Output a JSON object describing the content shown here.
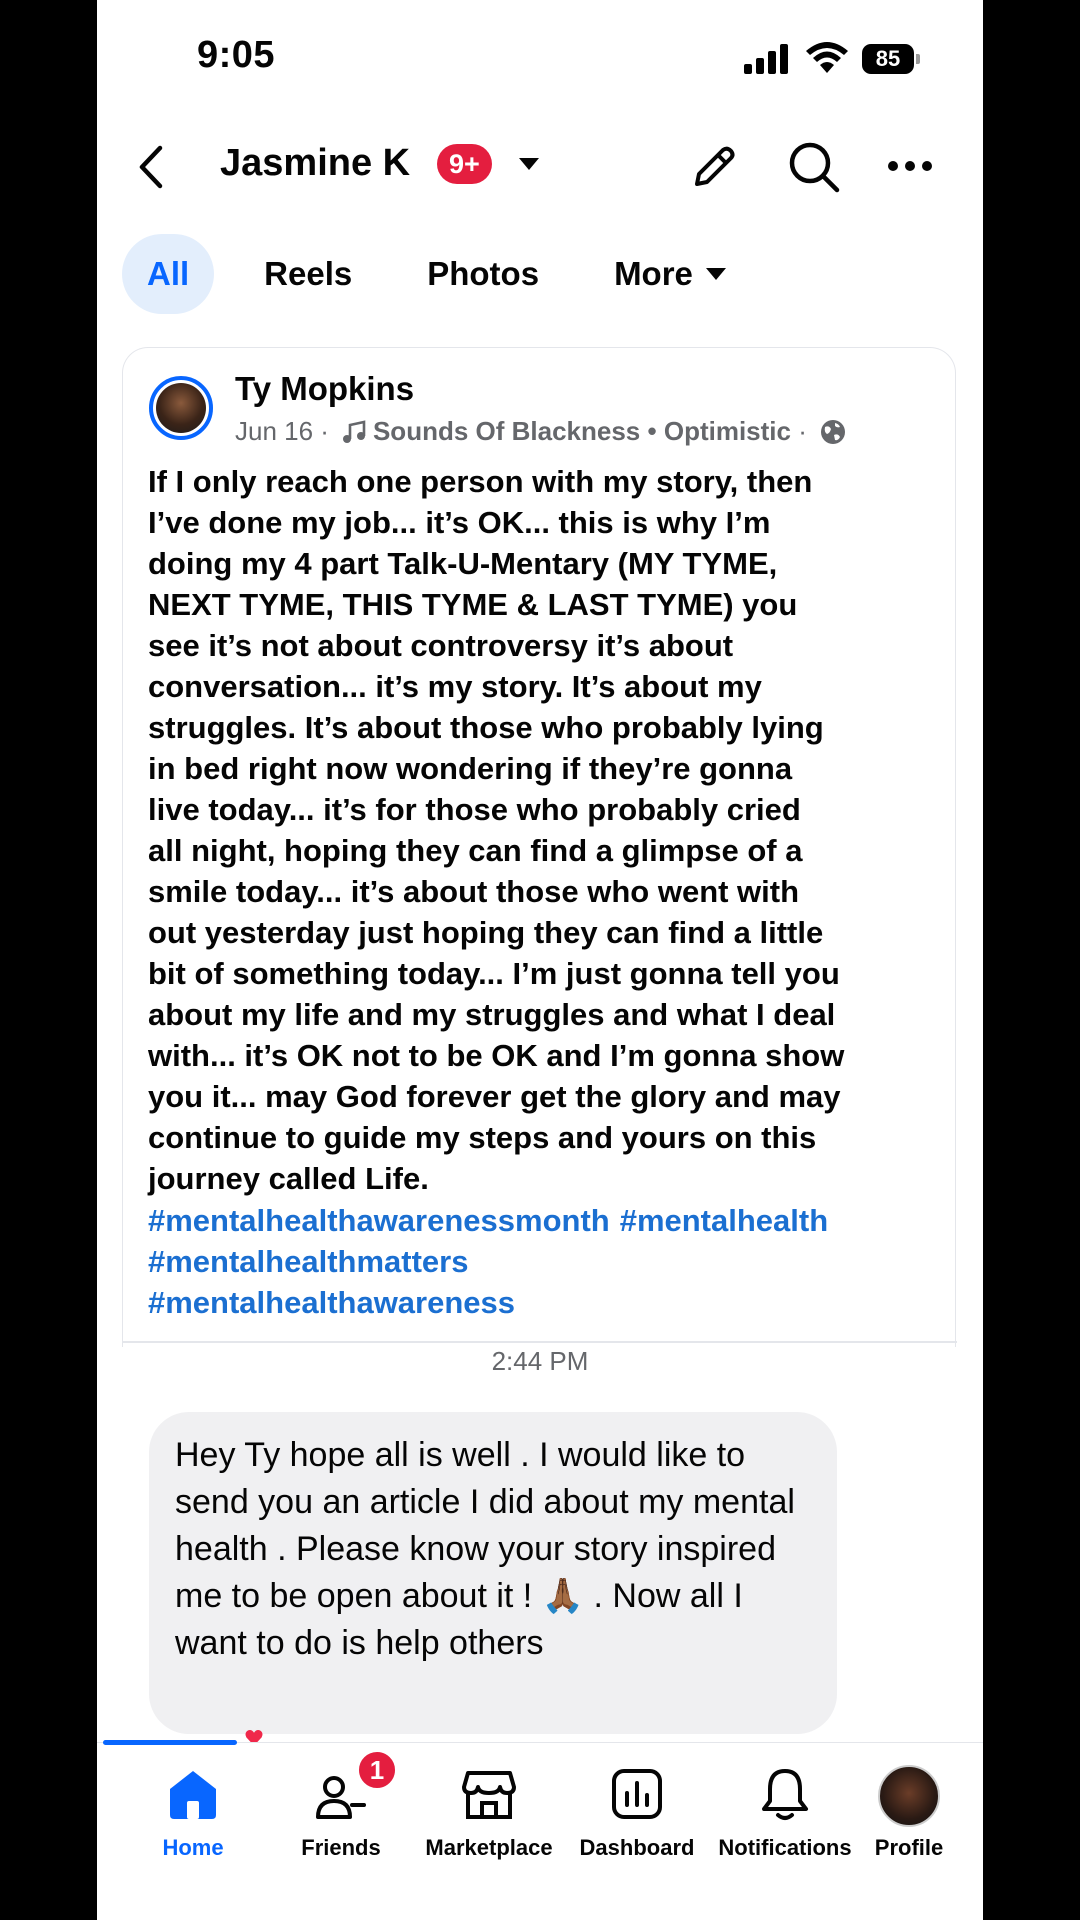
{
  "status_bar": {
    "time": "9:05",
    "battery": "85"
  },
  "header": {
    "title": "Jasmine K",
    "badge": "9+"
  },
  "tabs": [
    {
      "label": "All",
      "active": true
    },
    {
      "label": "Reels",
      "active": false
    },
    {
      "label": "Photos",
      "active": false
    },
    {
      "label": "More",
      "active": false
    }
  ],
  "post": {
    "author": "Ty Mopkins",
    "date": "Jun 16",
    "song": "Sounds Of Blackness",
    "mood": "Optimistic",
    "body": "If I only reach one person with my story, then\nI’ve done my job... it’s OK... this is why I’m\ndoing my 4 part Talk-U-Mentary (MY TYME,\nNEXT TYME, THIS TYME & LAST TYME) you\nsee it’s not about controversy it’s about\nconversation... it’s my story. It’s about my\nstruggles. It’s about those who probably lying\nin bed right now wondering if they’re gonna\nlive today... it’s for those who probably cried\nall night, hoping they can find a glimpse of a\nsmile today... it’s about those who went with\nout yesterday just hoping they can find a little\nbit of something today... I’m just gonna tell you\nabout my life and my struggles and what I deal\nwith... it’s OK not to be OK and I’m gonna show\nyou it... may God forever get the glory and may\ncontinue to guide my steps and yours on this\njourney called Life.",
    "hashtags": [
      "#mentalhealthawarenessmonth",
      "#mentalhealth",
      "#mentalhealthmatters",
      "#mentalhealthawareness"
    ]
  },
  "message": {
    "timestamp": "2:44 PM",
    "text_part1": "Hey Ty hope all is well . I would like to send you an article I did about my mental health . Please know your story inspired me to be open about it !",
    "emoji": "🙏🏾",
    "text_part2": ". Now all I want to do is help others"
  },
  "bottom_nav": [
    {
      "label": "Home",
      "icon": "home-icon",
      "active": true
    },
    {
      "label": "Friends",
      "icon": "friends-icon",
      "badge": "1"
    },
    {
      "label": "Marketplace",
      "icon": "marketplace-icon"
    },
    {
      "label": "Dashboard",
      "icon": "dashboard-icon"
    },
    {
      "label": "Notifications",
      "icon": "bell-icon"
    },
    {
      "label": "Profile",
      "icon": "profile-avatar"
    }
  ],
  "colors": {
    "accent": "#0866ff",
    "badge": "#e41e3f",
    "hashtag": "#1b6fd1",
    "secondary_text": "#65676b"
  }
}
